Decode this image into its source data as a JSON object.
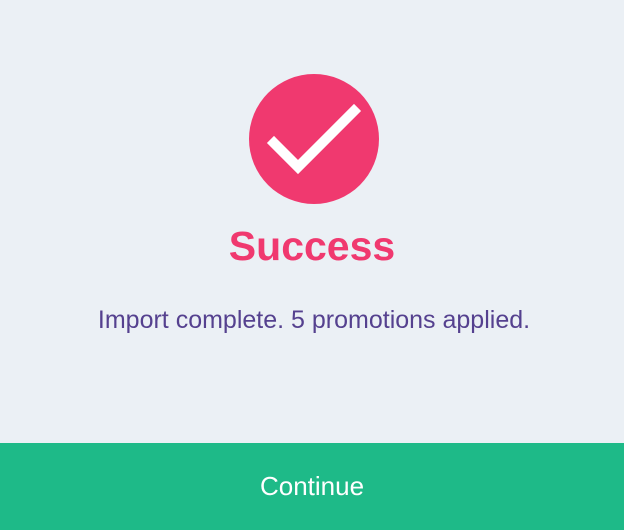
{
  "dialog": {
    "icon": "checkmark-icon",
    "title": "Success",
    "message": "Import complete. 5 promotions applied.",
    "continue_label": "Continue"
  },
  "colors": {
    "background": "#ebf0f5",
    "accent": "#f0396f",
    "message_text": "#55418f",
    "button": "#1eba88",
    "button_text": "#ffffff"
  }
}
